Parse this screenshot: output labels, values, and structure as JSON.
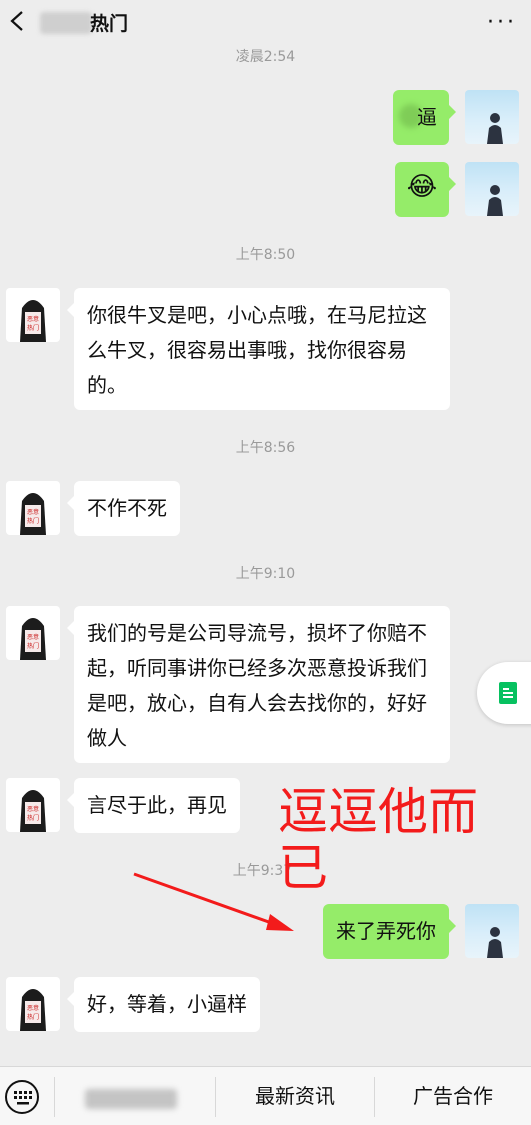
{
  "header": {
    "title": "热门"
  },
  "times": [
    "凌晨2:54",
    "上午8:50",
    "上午8:56",
    "上午9:10",
    "上午9:37"
  ],
  "messages": {
    "m1": "逼",
    "m2": "😂",
    "m3": "你很牛叉是吧，小心点哦，在马尼拉这么牛叉，很容易出事哦，找你很容易的。",
    "m4": "不作不死",
    "m5": "我们的号是公司导流号，损坏了你赔不起，听同事讲你已经多次恶意投诉我们是吧，放心，自有人会去找你的，好好做人",
    "m6": "言尽于此，再见",
    "m7": "来了弄死你",
    "m8": "好，等着，小逼样"
  },
  "annotation": {
    "text": "逗逗他而已"
  },
  "avatar_stamp": {
    "line1": "恶意",
    "line2": "热门"
  },
  "bottom_menu": {
    "item2": "最新资讯",
    "item3": "广告合作"
  },
  "colors": {
    "sent_bubble": "#95ec69",
    "received_bubble": "#ffffff",
    "annotation": "#f31b1b",
    "background": "#ededed"
  }
}
